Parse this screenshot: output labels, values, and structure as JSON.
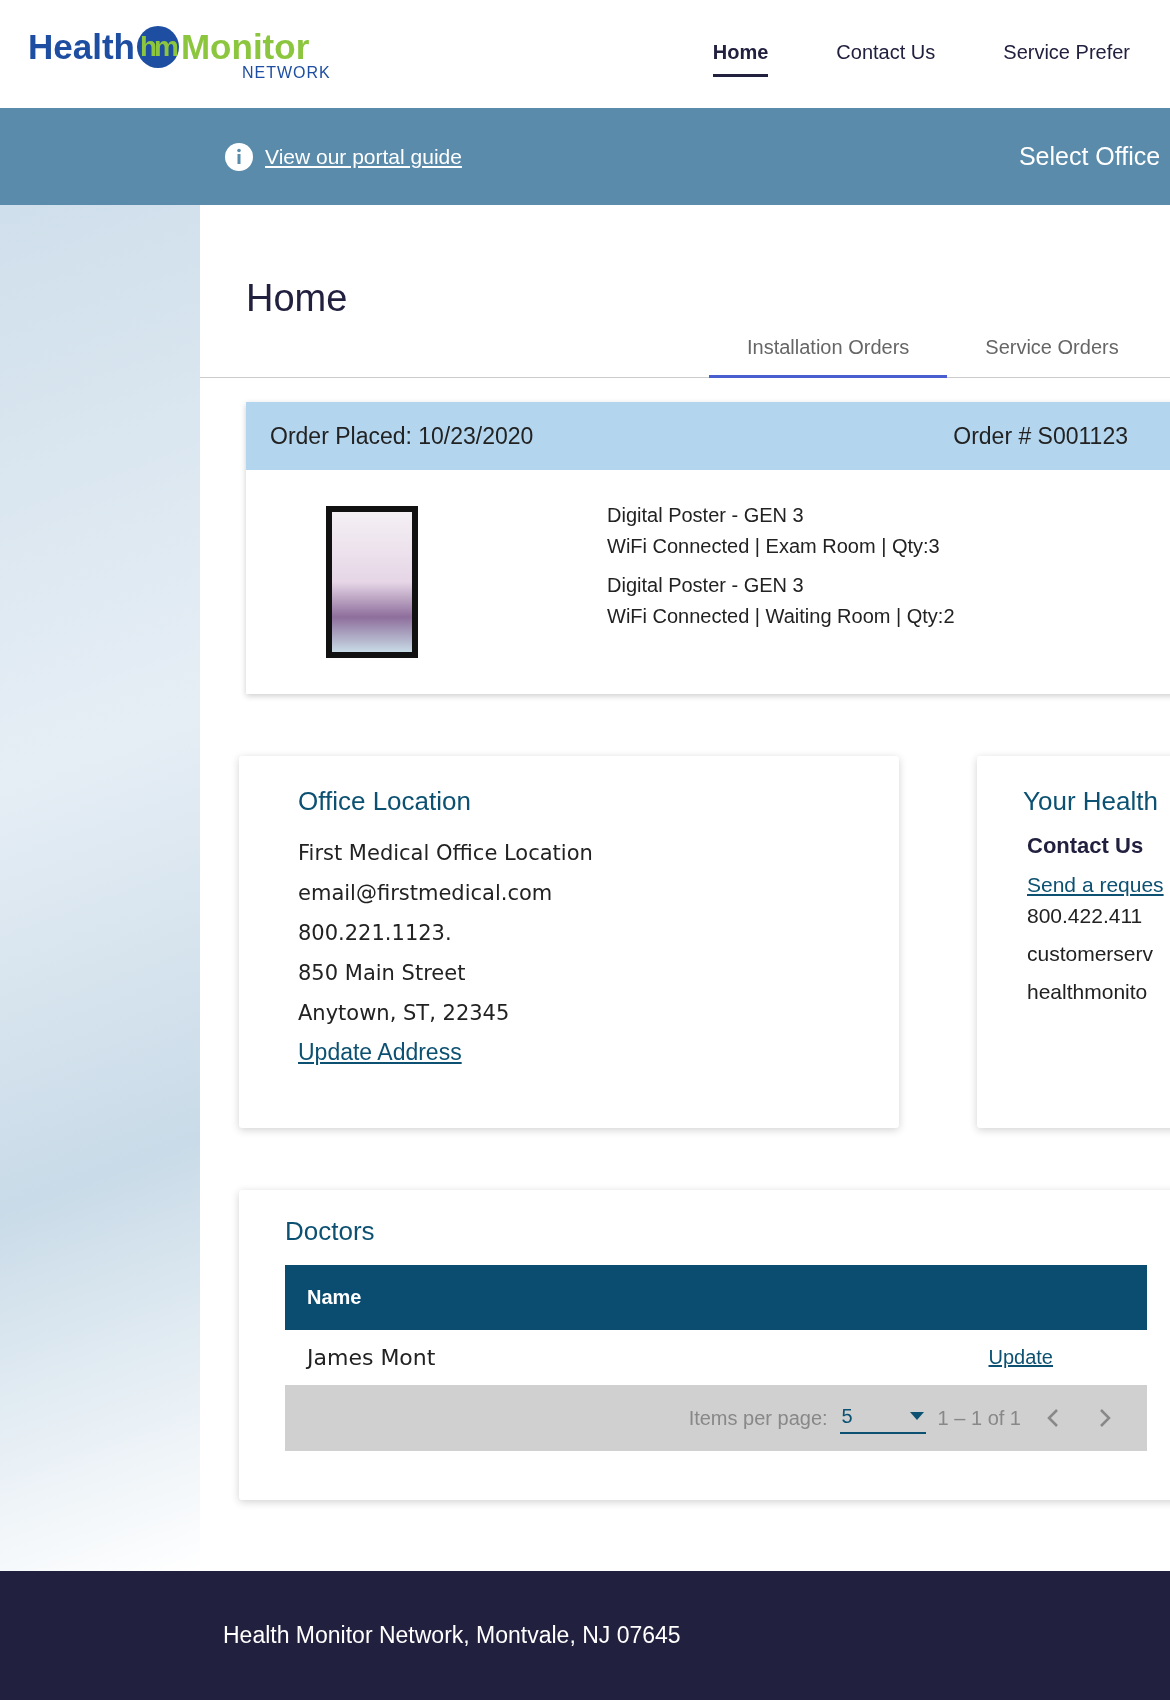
{
  "logo": {
    "word_1": "Health",
    "monogram": "hm",
    "word_2": "Monitor",
    "subtitle": "NETWORK"
  },
  "nav": [
    {
      "label": "Home",
      "selected": true
    },
    {
      "label": "Contact Us",
      "selected": false
    },
    {
      "label": "Service Prefer",
      "selected": false
    }
  ],
  "info_bar": {
    "guide_link": "View our portal guide",
    "office_select": "Select Office"
  },
  "page_title": "Home",
  "tabs": [
    {
      "label": "Installation Orders",
      "selected": true
    },
    {
      "label": "Service Orders",
      "selected": false
    }
  ],
  "order": {
    "placed": "Order Placed: 10/23/2020",
    "number": "Order # S001123",
    "items": [
      {
        "name": "Digital Poster - GEN 3",
        "details": "WiFi Connected | Exam Room | Qty:3"
      },
      {
        "name": "Digital Poster - GEN 3",
        "details": "WiFi Connected | Waiting Room | Qty:2"
      }
    ]
  },
  "office_location": {
    "title": "Office Location",
    "lines": [
      "First Medical Office Location",
      "email@firstmedical.com",
      "800.221.1123.",
      "850 Main Street",
      "Anytown, ST, 22345"
    ],
    "link": "Update Address"
  },
  "your_health": {
    "title": "Your Health",
    "subtitle": "Contact Us",
    "link": "Send a reques",
    "lines": [
      "800.422.411",
      "customerserv",
      "healthmonito"
    ]
  },
  "doctors": {
    "title": "Doctors",
    "columns": [
      "Name"
    ],
    "rows": [
      {
        "name": "James Mont",
        "action": "Update"
      }
    ],
    "pager": {
      "label": "Items per page:",
      "page_size": "5",
      "range": "1 – 1 of 1"
    }
  },
  "footer": "Health Monitor Network, Montvale, NJ 07645"
}
